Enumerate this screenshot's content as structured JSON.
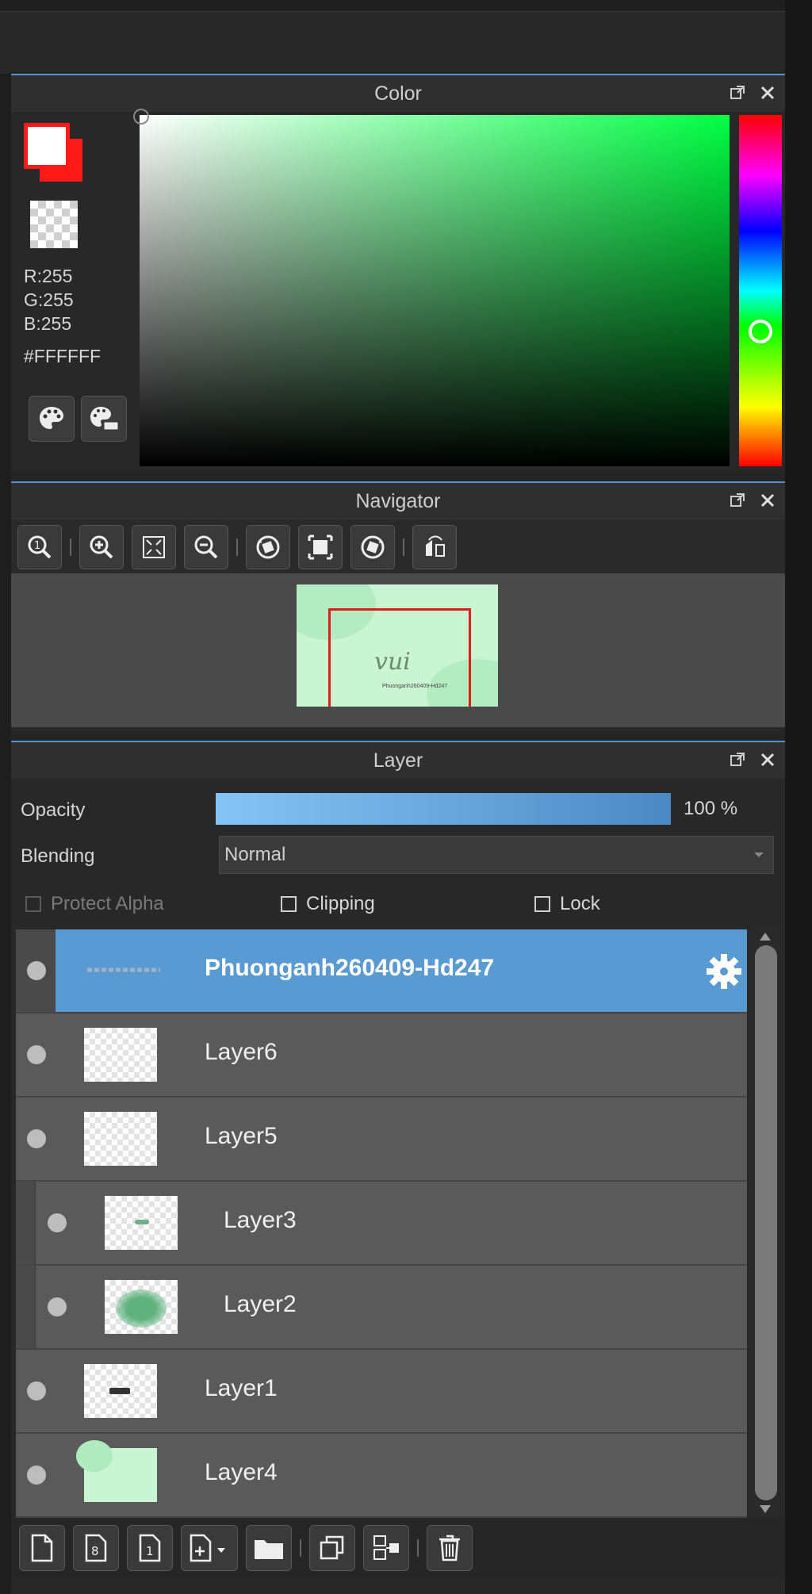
{
  "color_panel": {
    "title": "Color",
    "r": "R:255",
    "g": "G:255",
    "b": "B:255",
    "hex": "#FFFFFF",
    "primary_color": "#FFFFFF",
    "secondary_color": "#FF1A1A",
    "hue_color": "#00FF44"
  },
  "navigator_panel": {
    "title": "Navigator",
    "tools": [
      "zoom-actual-icon",
      "zoom-in-icon",
      "fit-screen-icon",
      "zoom-out-icon",
      "rotate-left-icon",
      "reset-view-icon",
      "rotate-right-icon",
      "flip-horizontal-icon"
    ]
  },
  "layer_panel": {
    "title": "Layer",
    "opacity_label": "Opacity",
    "opacity_value": "100 %",
    "opacity_level": 1.0,
    "blending_label": "Blending",
    "blending_value": "Normal",
    "protect_alpha": "Protect Alpha",
    "clipping": "Clipping",
    "lock": "Lock",
    "layers": [
      {
        "name": "Phuonganh260409-Hd247",
        "active": true
      },
      {
        "name": "Layer6"
      },
      {
        "name": "Layer5"
      },
      {
        "name": "Layer3",
        "clipped": true
      },
      {
        "name": "Layer2",
        "clipped": true
      },
      {
        "name": "Layer1"
      },
      {
        "name": "Layer4"
      }
    ]
  }
}
